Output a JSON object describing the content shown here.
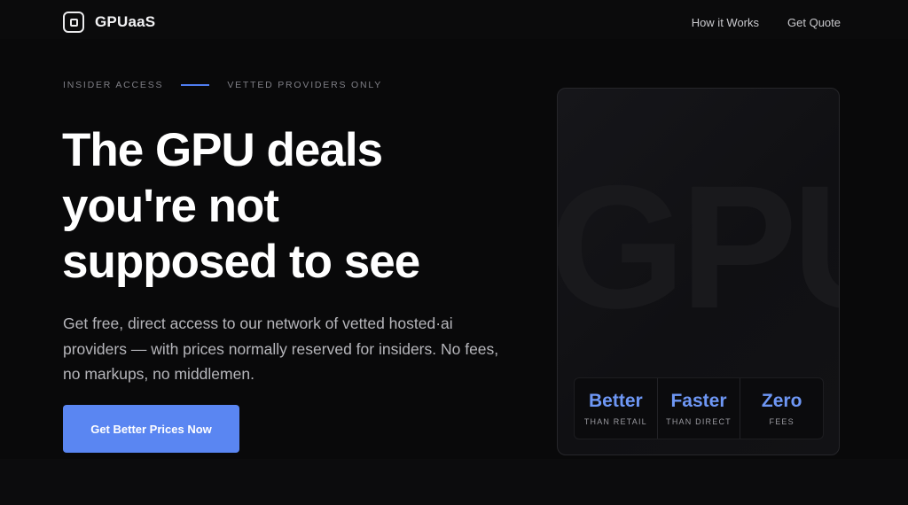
{
  "header": {
    "brand": "GPUaaS",
    "nav": [
      {
        "label": "How it Works"
      },
      {
        "label": "Get Quote"
      }
    ]
  },
  "hero": {
    "eyebrow_left": "INSIDER ACCESS",
    "eyebrow_right": "VETTED PROVIDERS ONLY",
    "headline_line1": "The GPU deals",
    "headline_line2": "you're not",
    "headline_line3": "supposed to see",
    "subtext": "Get free, direct access to our network of vetted hosted·ai providers — with prices normally reserved for insiders. No fees, no markups, no middlemen.",
    "cta_label": "Get Better Prices Now"
  },
  "card": {
    "background_text": "GPU",
    "stats": [
      {
        "value": "Better",
        "label": "THAN RETAIL"
      },
      {
        "value": "Faster",
        "label": "THAN DIRECT"
      },
      {
        "value": "Zero",
        "label": "FEES"
      }
    ]
  },
  "colors": {
    "accent": "#5a86f2",
    "stat_value": "#6e97f5",
    "background": "#0a0a0b"
  }
}
